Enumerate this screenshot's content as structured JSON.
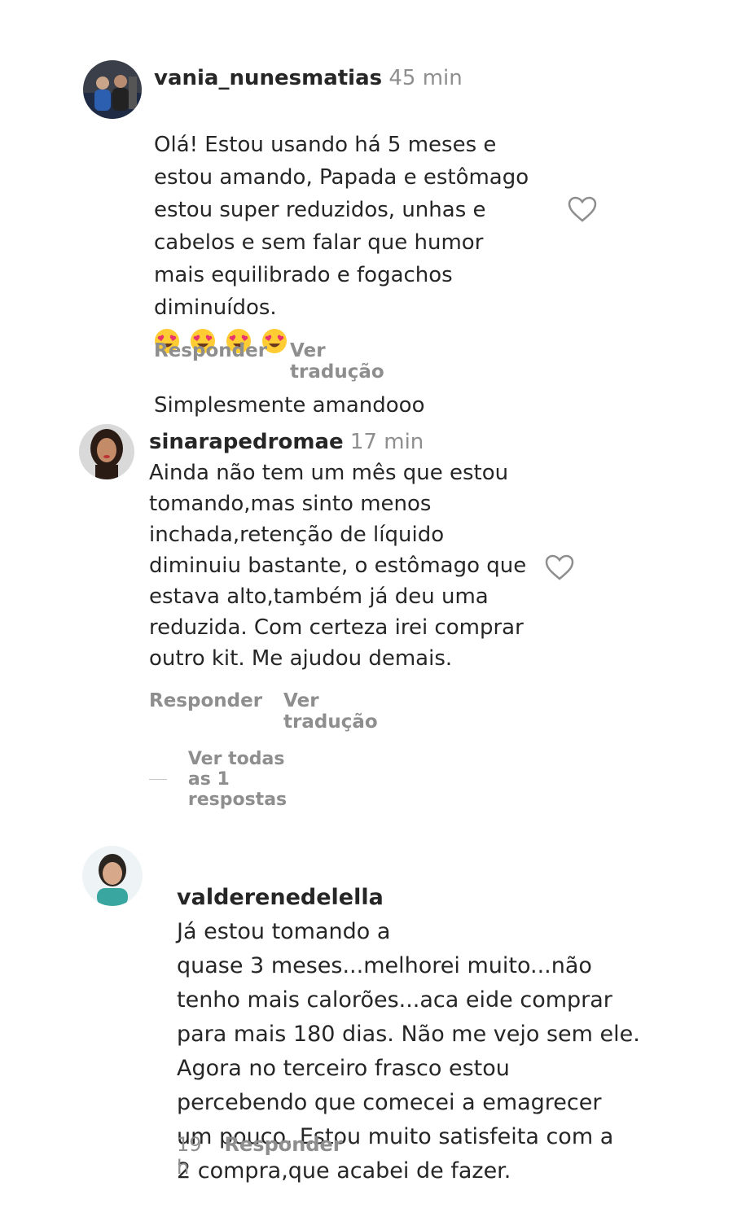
{
  "comments": [
    {
      "username": "vania_nunesmatias",
      "time": "45 min",
      "text_before_emoji": "Olá! Estou usando há 5 meses e\nestou amando, Papada e estômago\nestou super reduzidos, unhas e\ncabelos e sem falar que humor\nmais equilibrado e fogachos\ndiminuídos.",
      "emojis": "😍😍😍😍",
      "text_after_emoji": "Simplesmente amandooo",
      "actions": [
        "Responder",
        "Ver tradução"
      ],
      "avatar_icon": "avatar-photo"
    },
    {
      "username": "sinarapedromae",
      "time": "17 min",
      "text": "Ainda não tem um mês que estou\ntomando,mas sinto menos\ninchada,retenção de líquido\ndiminuiu bastante, o estômago que\nestava alto,também já deu uma\nreduzida. Com certeza irei comprar\noutro kit. Me ajudou demais.",
      "actions": [
        "Responder",
        "Ver tradução"
      ],
      "view_replies": "Ver todas as 1 respostas",
      "avatar_icon": "avatar-photo"
    },
    {
      "username": "valderenedelella",
      "text_first_line": "Já estou tomando a",
      "text": "quase 3 meses...melhorei muito...não\ntenho mais calorões...aca eide comprar\npara mais 180 dias. Não me vejo sem ele.\nAgora no terceiro frasco estou\npercebendo que comecei a emagrecer\num pouco. Estou muito satisfeita com a\n2 compra,que acabei de fazer.",
      "time": "19 h",
      "actions": [
        "Responder"
      ],
      "avatar_icon": "avatar-photo"
    }
  ],
  "colors": {
    "text": "#262626",
    "muted": "#8e8e8e",
    "heart_stroke": "#8e8e8e"
  },
  "icons": {
    "heart": "heart-outline-icon",
    "emoji": "heart-eyes-emoji"
  }
}
